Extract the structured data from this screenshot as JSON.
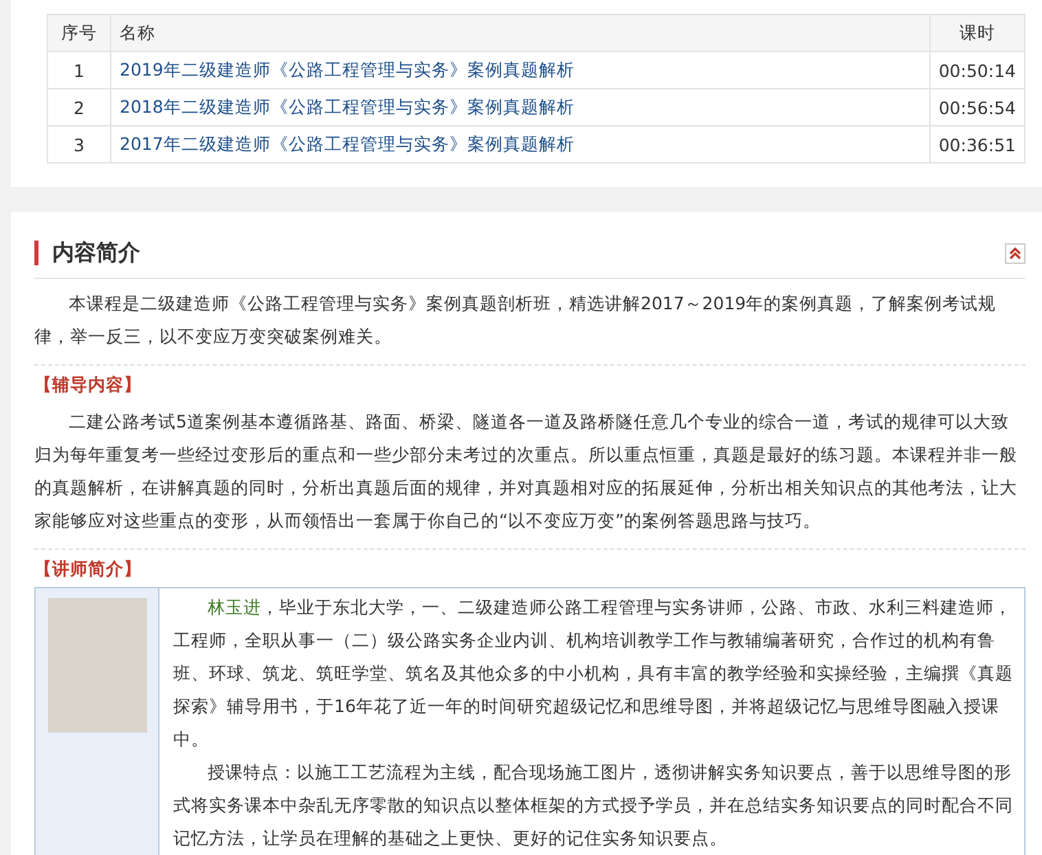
{
  "lesson_table": {
    "columns": [
      "序号",
      "名称",
      "课时"
    ],
    "rows": [
      {
        "index": "1",
        "name": "2019年二级建造师《公路工程管理与实务》案例真题解析",
        "duration": "00:50:14"
      },
      {
        "index": "2",
        "name": "2018年二级建造师《公路工程管理与实务》案例真题解析",
        "duration": "00:56:54"
      },
      {
        "index": "3",
        "name": "2017年二级建造师《公路工程管理与实务》案例真题解析",
        "duration": "00:36:51"
      }
    ]
  },
  "intro": {
    "title": "内容简介",
    "summary": "本课程是二级建造师《公路工程管理与实务》案例真题剖析班，精选讲解2017～2019年的案例真题，了解案例考试规律，举一反三，以不变应万变突破案例难关。",
    "guidance_heading": "【辅导内容】",
    "guidance": "二建公路考试5道案例基本遵循路基、路面、桥梁、隧道各一道及路桥隧任意几个专业的综合一道，考试的规律可以大致归为每年重复考一些经过变形后的重点和一些少部分未考过的次重点。所以重点恒重，真题是最好的练习题。本课程并非一般的真题解析，在讲解真题的同时，分析出真题后面的规律，并对真题相对应的拓展延伸，分析出相关知识点的其他考法，让大家能够应对这些重点的变形，从而领悟出一套属于你自己的“以不变应万变”的案例答题思路与技巧。",
    "teacher_heading": "【讲师简介】",
    "teacher": {
      "name": "林玉进",
      "bio": "，毕业于东北大学，一、二级建造师公路工程管理与实务讲师，公路、市政、水利三料建造师，工程师，全职从事一（二）级公路实务企业内训、机构培训教学工作与教辅编著研究，合作过的机构有鲁班、环球、筑龙、筑旺学堂、筑名及其他众多的中小机构，具有丰富的教学经验和实操经验，主编撰《真题探索》辅导用书，于16年花了近一年的时间研究超级记忆和思维导图，并将超级记忆与思维导图融入授课中。",
      "style": "授课特点：以施工工艺流程为主线，配合现场施工图片，透彻讲解实务知识要点，善于以思维导图的形式将实务课本中杂乱无序零散的知识点以整体框架的方式授予学员，并在总结实务知识要点的同时配合不同记忆方法，让学员在理解的基础之上更快、更好的记住实务知识要点。"
    }
  }
}
